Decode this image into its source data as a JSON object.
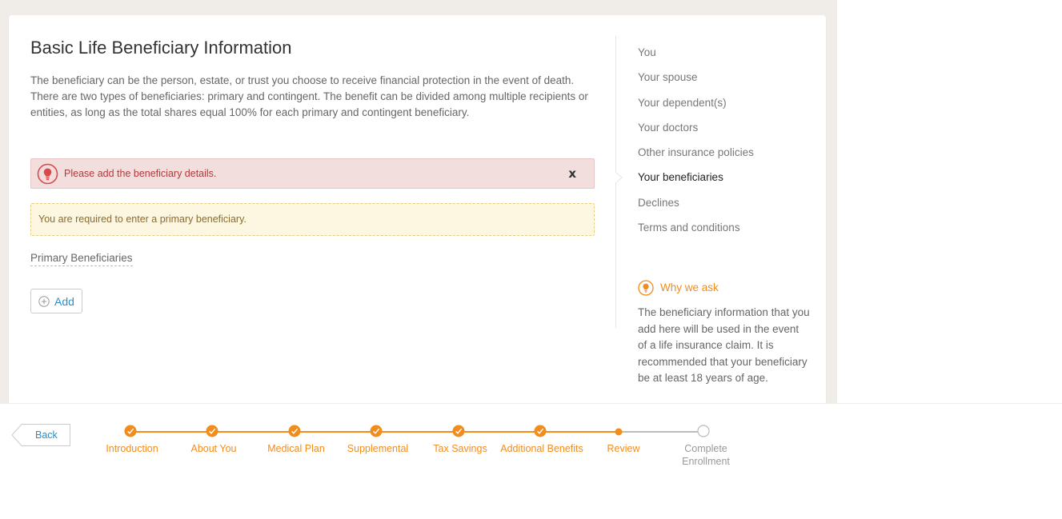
{
  "page": {
    "title": "Basic Life Beneficiary Information",
    "intro": "The beneficiary can be the person, estate, or trust you choose to receive financial protection in the event of death. There are two types of beneficiaries: primary and contingent. The benefit can be divided among multiple recipients or entities, as long as the total shares equal 100% for each primary and contingent beneficiary."
  },
  "alerts": {
    "error_text": "Please add the beneficiary details.",
    "error_close": "x",
    "warning_text": "You are required to enter a primary beneficiary."
  },
  "beneficiaries": {
    "section_label": "Primary Beneficiaries",
    "add_label": "Add"
  },
  "side_nav": {
    "items": [
      {
        "label": "You"
      },
      {
        "label": "Your spouse"
      },
      {
        "label": "Your dependent(s)"
      },
      {
        "label": "Your doctors"
      },
      {
        "label": "Other insurance policies"
      },
      {
        "label": "Your beneficiaries"
      },
      {
        "label": "Declines"
      },
      {
        "label": "Terms and conditions"
      }
    ],
    "active_label": "Your beneficiaries"
  },
  "why_we_ask": {
    "title": "Why we ask",
    "body": "The beneficiary information that you add here will be used in the event of a life insurance claim. It is recommended that your beneficiary be at least 18 years of age."
  },
  "footer": {
    "back_label": "Back",
    "steps": [
      {
        "label": "Introduction",
        "status": "complete"
      },
      {
        "label": "About You",
        "status": "complete"
      },
      {
        "label": "Medical Plan",
        "status": "complete"
      },
      {
        "label": "Supplemental",
        "status": "complete"
      },
      {
        "label": "Tax Savings",
        "status": "complete"
      },
      {
        "label": "Additional Benefits",
        "status": "complete"
      },
      {
        "label": "Review",
        "status": "current"
      },
      {
        "label": "Complete Enrollment",
        "status": "pending"
      }
    ]
  },
  "colors": {
    "accent": "#f28c1c",
    "link": "#2a8fc7",
    "error_bg": "#f3dede",
    "error_text": "#b03a3a",
    "warning_bg": "#fdf6e0",
    "page_bg": "#f0ede8"
  },
  "icons": {
    "error": "lightbulb-alert-icon",
    "add": "plus-circle-icon",
    "why": "lightbulb-icon",
    "step_complete": "check-icon"
  }
}
